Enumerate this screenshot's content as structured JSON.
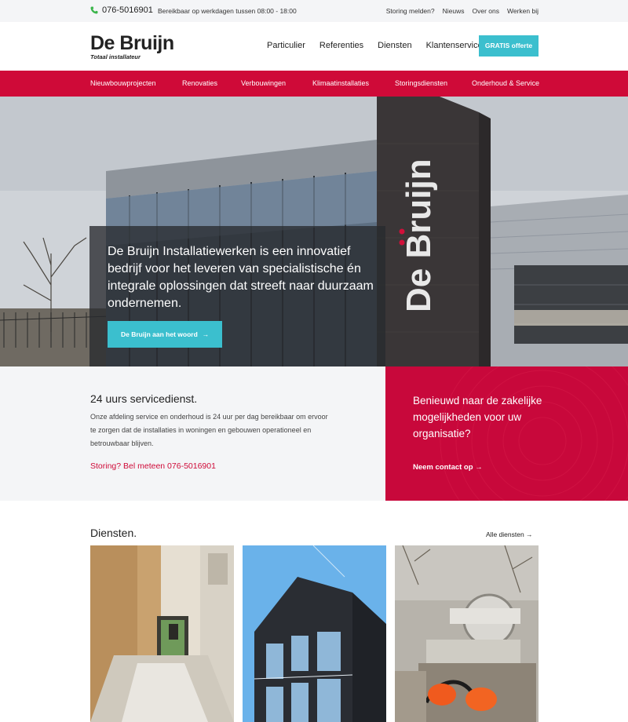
{
  "topbar": {
    "phone": "076-5016901",
    "hours": "Bereikbaar op werkdagen tussen 08:00 - 18:00",
    "links": [
      "Storing melden?",
      "Nieuws",
      "Over ons",
      "Werken bij"
    ]
  },
  "header": {
    "logo_name": "De Bruijn",
    "logo_tagline": "Totaal installateur",
    "nav": [
      "Particulier",
      "Referenties",
      "Diensten",
      "Klantenservice"
    ],
    "cta": "GRATIS offerte"
  },
  "rednav": [
    "Nieuwbouwprojecten",
    "Renovaties",
    "Verbouwingen",
    "Klimaatinstallaties",
    "Storingsdiensten",
    "Onderhoud & Service"
  ],
  "hero": {
    "building_sign": "De Bruijn",
    "text": "De Bruijn Installatiewerken is een innovatief bedrijf voor het leveren van specialistische én integrale oplossingen dat streeft naar duurzaam ondernemen.",
    "button": "De Bruijn aan het woord",
    "arrow": "→"
  },
  "service": {
    "title": "24 uurs servicedienst.",
    "body": "Onze afdeling service en onderhoud is 24 uur per dag bereikbaar om ervoor te zorgen dat de installaties in woningen en gebouwen operationeel en betrouwbaar blijven.",
    "call": "Storing? Bel meteen 076-5016901"
  },
  "contact": {
    "title": "Benieuwd naar de zakelijke mogelijkheden voor uw organisatie?",
    "link": "Neem contact op",
    "arrow": "→"
  },
  "diensten": {
    "title": "Diensten.",
    "all_link": "Alle diensten",
    "arrow": "→"
  },
  "colors": {
    "brand_red": "#cf0a38",
    "accent_teal": "#3bbfce",
    "topbar_bg": "#f4f5f7"
  }
}
